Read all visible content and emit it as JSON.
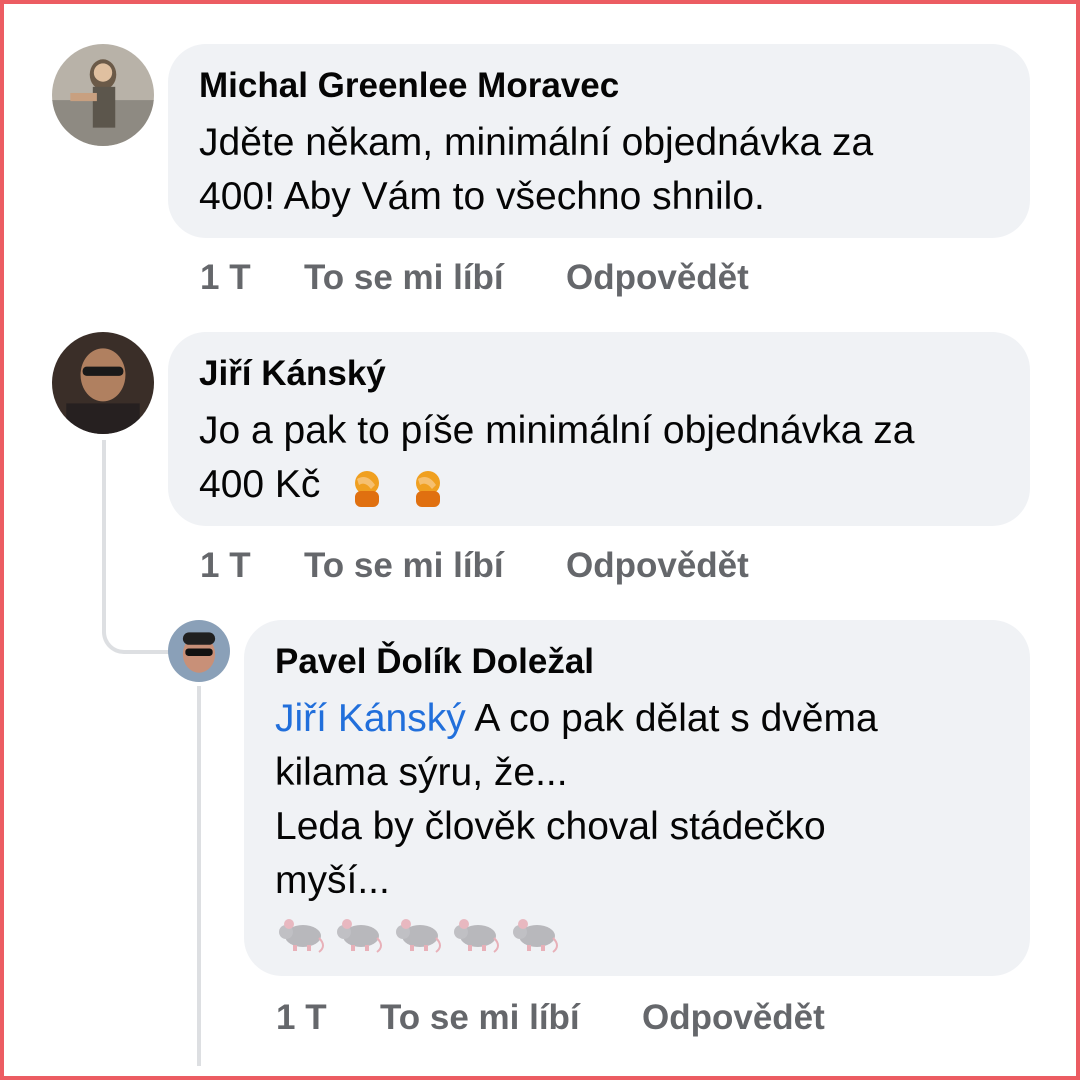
{
  "comments": [
    {
      "author": "Michal Greenlee Moravec",
      "lines": [
        "Jděte někam, minimální objednávka za",
        "400! Aby Vám to všechno shnilo."
      ],
      "time": "1 T",
      "like": "To se mi líbí",
      "reply": "Odpovědět"
    },
    {
      "author": "Jiří Kánský",
      "lines": [
        "Jo a pak to píše minimální objednávka za",
        "400 Kč"
      ],
      "emoji": "facepalm-emoji",
      "time": "1 T",
      "like": "To se mi líbí",
      "reply": "Odpovědět"
    },
    {
      "author": "Pavel Ďolík Doležal",
      "mention": "Jiří Kánský",
      "lines": [
        " A co pak dělat s dvěma",
        "kilama sýru, že...",
        "Leda by člověk choval stádečko",
        "myší..."
      ],
      "emoji": "mouse-emoji",
      "time": "1 T",
      "like": "To se mi líbí",
      "reply": "Odpovědět"
    }
  ],
  "colors": {
    "frame": "#ec5c62",
    "bubble": "#f0f2f5",
    "mention": "#216fdb",
    "action": "#65676b"
  }
}
